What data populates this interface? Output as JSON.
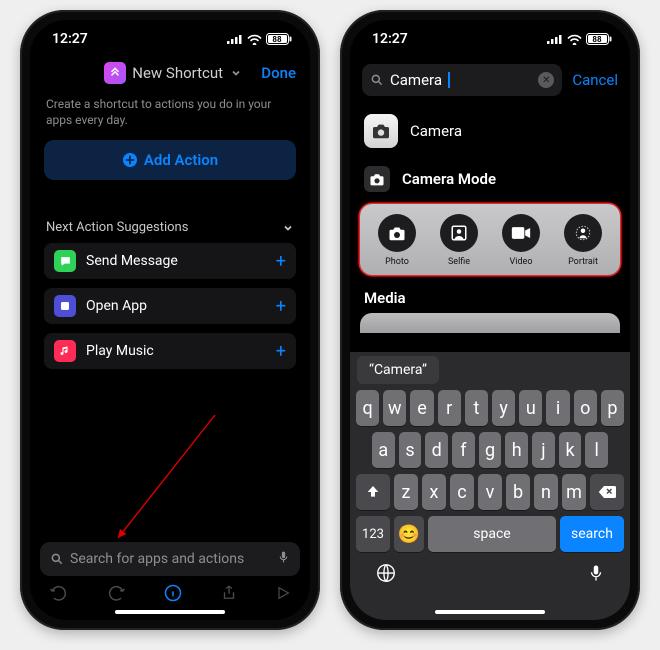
{
  "status": {
    "time": "12:27",
    "battery": "88"
  },
  "left": {
    "title": "New Shortcut",
    "done": "Done",
    "subtitle": "Create a shortcut to actions you do in your apps every day.",
    "add_action": "Add Action",
    "suggestions_header": "Next Action Suggestions",
    "suggestions": [
      {
        "label": "Send Message",
        "icon": "message"
      },
      {
        "label": "Open App",
        "icon": "app"
      },
      {
        "label": "Play Music",
        "icon": "music"
      }
    ],
    "search_placeholder": "Search for apps and actions"
  },
  "right": {
    "search_value": "Camera",
    "cancel": "Cancel",
    "app_result": "Camera",
    "section_camera_mode": "Camera Mode",
    "modes": [
      {
        "label": "Photo",
        "icon": "photo"
      },
      {
        "label": "Selfie",
        "icon": "selfie"
      },
      {
        "label": "Video",
        "icon": "video"
      },
      {
        "label": "Portrait",
        "icon": "portrait"
      }
    ],
    "section_media": "Media",
    "autocorrect": "“Camera”",
    "keys_r1": [
      "q",
      "w",
      "e",
      "r",
      "t",
      "y",
      "u",
      "i",
      "o",
      "p"
    ],
    "keys_r2": [
      "a",
      "s",
      "d",
      "f",
      "g",
      "h",
      "j",
      "k",
      "l"
    ],
    "keys_r3": [
      "z",
      "x",
      "c",
      "v",
      "b",
      "n",
      "m"
    ],
    "key_123": "123",
    "key_space": "space",
    "key_search": "search"
  }
}
